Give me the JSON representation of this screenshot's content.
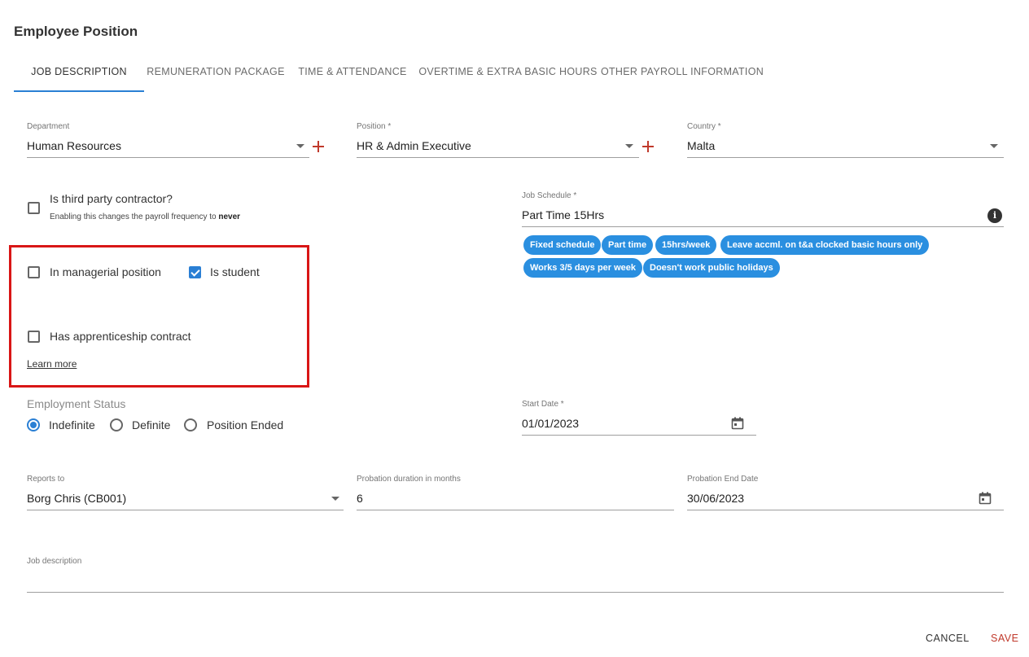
{
  "page": {
    "title": "Employee Position"
  },
  "tabs": [
    {
      "label": "JOB DESCRIPTION"
    },
    {
      "label": "REMUNERATION PACKAGE"
    },
    {
      "label": "TIME & ATTENDANCE"
    },
    {
      "label": "OVERTIME & EXTRA BASIC HOURS"
    },
    {
      "label": "OTHER PAYROLL INFORMATION"
    }
  ],
  "fields": {
    "department": {
      "label": "Department",
      "value": "Human Resources"
    },
    "position": {
      "label": "Position *",
      "value": "HR & Admin Executive"
    },
    "country": {
      "label": "Country *",
      "value": "Malta"
    },
    "job_schedule": {
      "label": "Job Schedule *",
      "value": "Part Time 15Hrs"
    },
    "start_date": {
      "label": "Start Date *",
      "value": "01/01/2023"
    },
    "reports_to": {
      "label": "Reports to",
      "value": "Borg Chris (CB001)"
    },
    "probation_duration": {
      "label": "Probation duration in months",
      "value": "6"
    },
    "probation_end": {
      "label": "Probation End Date",
      "value": "30/06/2023"
    },
    "job_description": {
      "label": "Job description",
      "value": ""
    }
  },
  "third_party": {
    "label": "Is third party contractor?",
    "hint_prefix": "Enabling this changes the payroll frequency to",
    "hint_value": "never",
    "checked": false
  },
  "checkboxes": {
    "managerial": {
      "label": "In managerial position",
      "checked": false
    },
    "student": {
      "label": "Is student",
      "checked": true
    },
    "apprenticeship": {
      "label": "Has apprenticeship contract",
      "checked": false
    },
    "learn_more": "Learn more"
  },
  "employment_status": {
    "label": "Employment Status",
    "options": [
      {
        "label": "Indefinite",
        "selected": true
      },
      {
        "label": "Definite",
        "selected": false
      },
      {
        "label": "Position Ended",
        "selected": false
      }
    ]
  },
  "schedule_chips": [
    "Fixed schedule",
    "Part time",
    "15hrs/week",
    "Leave accml. on t&a clocked basic hours only",
    "Works 3/5 days per week",
    "Doesn't work public holidays"
  ],
  "actions": {
    "cancel": "CANCEL",
    "save": "SAVE"
  },
  "colors": {
    "accent": "#2a7fd4",
    "chip": "#2a8fe0",
    "danger": "#c0392b",
    "highlight": "#d91616"
  },
  "icons": {
    "info": "info-icon",
    "calendar": "calendar-icon",
    "add": "plus-icon",
    "dropdown": "chevron-down-icon"
  }
}
